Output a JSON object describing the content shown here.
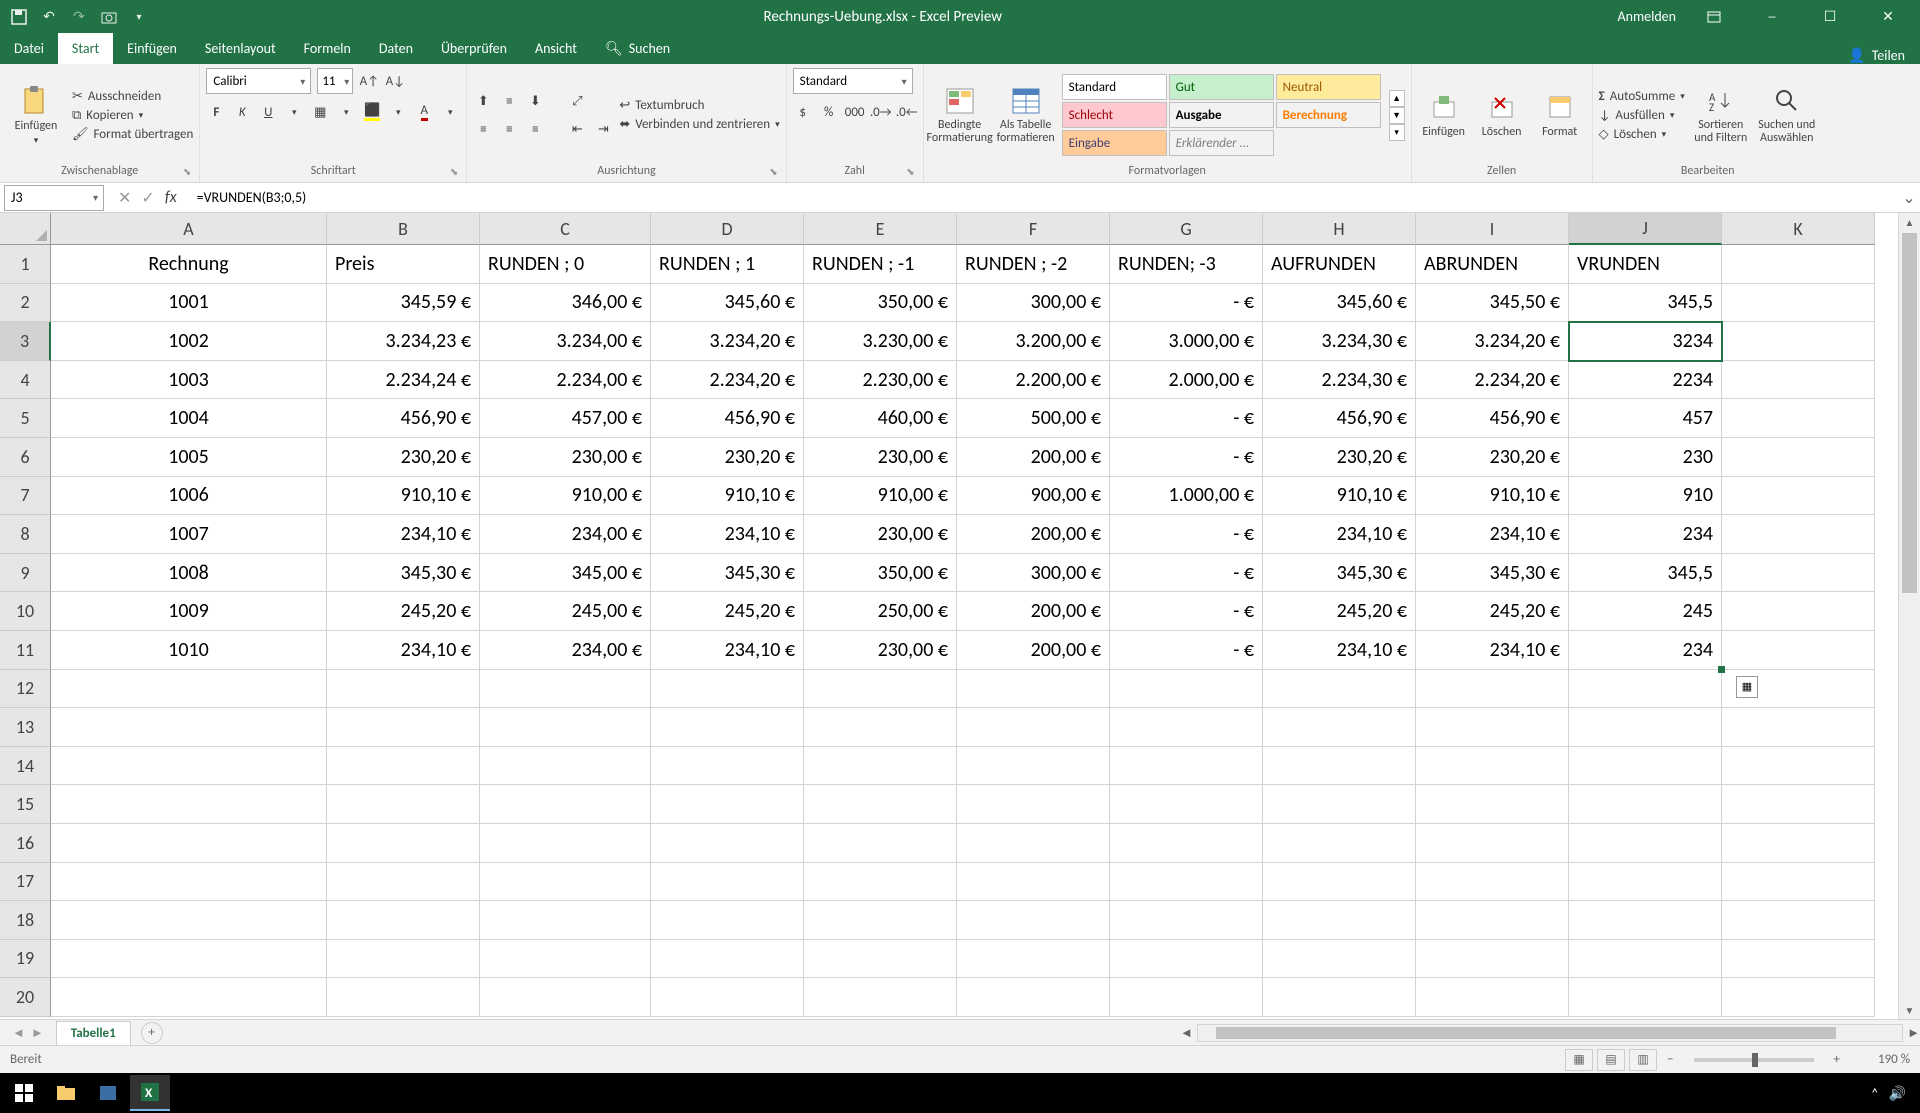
{
  "title": "Rechnungs-Uebung.xlsx - Excel Preview",
  "signin": "Anmelden",
  "tabs": {
    "file": "Datei",
    "home": "Start",
    "insert": "Einfügen",
    "pagelayout": "Seitenlayout",
    "formulas": "Formeln",
    "data": "Daten",
    "review": "Überprüfen",
    "view": "Ansicht",
    "search": "Suchen"
  },
  "share": "Teilen",
  "clipboard": {
    "paste": "Einfügen",
    "cut": "Ausschneiden",
    "copy": "Kopieren",
    "format_painter": "Format übertragen",
    "label": "Zwischenablage"
  },
  "font": {
    "name": "Calibri",
    "size": "11",
    "label": "Schriftart"
  },
  "alignment": {
    "wrap": "Textumbruch",
    "merge": "Verbinden und zentrieren",
    "label": "Ausrichtung"
  },
  "number": {
    "format": "Standard",
    "label": "Zahl"
  },
  "styles": {
    "cond": "Bedingte Formatierung",
    "table": "Als Tabelle formatieren",
    "s1": "Standard",
    "s2": "Gut",
    "s3": "Neutral",
    "s4": "Schlecht",
    "s5": "Ausgabe",
    "s6": "Berechnung",
    "s7": "Eingabe",
    "s8": "Erklärender ...",
    "label": "Formatvorlagen"
  },
  "cells": {
    "insert": "Einfügen",
    "delete": "Löschen",
    "format": "Format",
    "label": "Zellen"
  },
  "editing": {
    "sum": "AutoSumme",
    "fill": "Ausfüllen",
    "clear": "Löschen",
    "sort": "Sortieren und Filtern",
    "find": "Suchen und Auswählen",
    "label": "Bearbeiten"
  },
  "namebox": "J3",
  "formula": "=VRUNDEN(B3;0,5)",
  "columns": [
    "A",
    "B",
    "C",
    "D",
    "E",
    "F",
    "G",
    "H",
    "I",
    "J",
    "K"
  ],
  "col_widths": [
    "col-w-A",
    "col-w-B",
    "col-w-C",
    "col-w-D",
    "col-w-E",
    "col-w-F",
    "col-w-G",
    "col-w-H",
    "col-w-I",
    "col-w-J",
    "col-w-K"
  ],
  "selected_col": "J",
  "selected_row": 3,
  "headers": [
    "Rechnung",
    "Preis",
    "RUNDEN ; 0",
    "RUNDEN ; 1",
    "RUNDEN ; -1",
    "RUNDEN ; -2",
    "RUNDEN; -3",
    "AUFRUNDEN",
    "ABRUNDEN",
    "VRUNDEN",
    ""
  ],
  "header_align": [
    "center",
    "left",
    "left",
    "left",
    "left",
    "left",
    "left",
    "left",
    "left",
    "left",
    "left"
  ],
  "rows": [
    [
      "1001",
      "345,59 €",
      "346,00 €",
      "345,60 €",
      "350,00 €",
      "300,00 €",
      "-   €",
      "345,60 €",
      "345,50 €",
      "345,5",
      ""
    ],
    [
      "1002",
      "3.234,23 €",
      "3.234,00 €",
      "3.234,20 €",
      "3.230,00 €",
      "3.200,00 €",
      "3.000,00 €",
      "3.234,30 €",
      "3.234,20 €",
      "3234",
      ""
    ],
    [
      "1003",
      "2.234,24 €",
      "2.234,00 €",
      "2.234,20 €",
      "2.230,00 €",
      "2.200,00 €",
      "2.000,00 €",
      "2.234,30 €",
      "2.234,20 €",
      "2234",
      ""
    ],
    [
      "1004",
      "456,90 €",
      "457,00 €",
      "456,90 €",
      "460,00 €",
      "500,00 €",
      "-   €",
      "456,90 €",
      "456,90 €",
      "457",
      ""
    ],
    [
      "1005",
      "230,20 €",
      "230,00 €",
      "230,20 €",
      "230,00 €",
      "200,00 €",
      "-   €",
      "230,20 €",
      "230,20 €",
      "230",
      ""
    ],
    [
      "1006",
      "910,10 €",
      "910,00 €",
      "910,10 €",
      "910,00 €",
      "900,00 €",
      "1.000,00 €",
      "910,10 €",
      "910,10 €",
      "910",
      ""
    ],
    [
      "1007",
      "234,10 €",
      "234,00 €",
      "234,10 €",
      "230,00 €",
      "200,00 €",
      "-   €",
      "234,10 €",
      "234,10 €",
      "234",
      ""
    ],
    [
      "1008",
      "345,30 €",
      "345,00 €",
      "345,30 €",
      "350,00 €",
      "300,00 €",
      "-   €",
      "345,30 €",
      "345,30 €",
      "345,5",
      ""
    ],
    [
      "1009",
      "245,20 €",
      "245,00 €",
      "245,20 €",
      "250,00 €",
      "200,00 €",
      "-   €",
      "245,20 €",
      "245,20 €",
      "245",
      ""
    ],
    [
      "1010",
      "234,10 €",
      "234,00 €",
      "234,10 €",
      "230,00 €",
      "200,00 €",
      "-   €",
      "234,10 €",
      "234,10 €",
      "234",
      ""
    ]
  ],
  "cell_align": [
    "center",
    "right",
    "right",
    "right",
    "right",
    "right",
    "right",
    "right",
    "right",
    "right",
    "right"
  ],
  "total_rows": 20,
  "sheet": "Tabelle1",
  "status": "Bereit",
  "zoom": "190 %"
}
